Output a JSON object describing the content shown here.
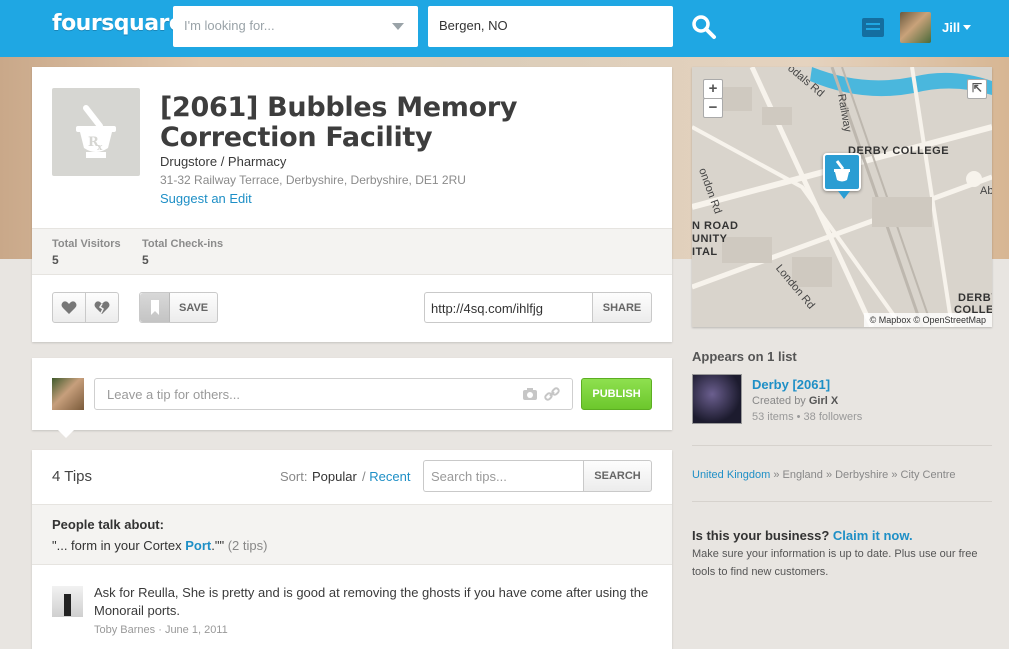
{
  "header": {
    "logo": "foursquare",
    "search_what_placeholder": "I'm looking for...",
    "search_where_value": "Bergen, NO",
    "user_name": "Jill"
  },
  "venue": {
    "title": "[2061] Bubbles Memory Correction Facility",
    "category": "Drugstore / Pharmacy",
    "address": "31-32 Railway Terrace, Derbyshire, Derbyshire, DE1 2RU",
    "suggest_edit": "Suggest an Edit",
    "stats": [
      {
        "label": "Total Visitors",
        "value": "5"
      },
      {
        "label": "Total Check-ins",
        "value": "5"
      }
    ],
    "save_label": "SAVE",
    "share_url": "http://4sq.com/ihlfjg",
    "share_label": "SHARE"
  },
  "tip_composer": {
    "placeholder": "Leave a tip for others...",
    "publish_label": "PUBLISH"
  },
  "tips": {
    "title": "4 Tips",
    "sort_label": "Sort:",
    "sort_popular": "Popular",
    "sort_separator": "/",
    "sort_recent": "Recent",
    "search_placeholder": "Search tips...",
    "search_label": "SEARCH",
    "talk_title": "People talk about:",
    "talk_quote_pre": "\"... form in your Cortex ",
    "talk_quote_highlight": "Port",
    "talk_quote_post": ".\"\"",
    "talk_quote_count": "(2 tips)",
    "items": [
      {
        "text": "Ask for Reulla, She is pretty and is good at removing the ghosts if you have come after using the Monorail ports.",
        "author": "Toby Barnes",
        "date": "June 1, 2011"
      }
    ]
  },
  "map": {
    "labels": [
      "DERBY COLLEGE",
      "N ROAD",
      "UNITY",
      "ITAL",
      "DERBY",
      "COLLEG"
    ],
    "roads": [
      "Railway",
      "odals Rd",
      "London Rd",
      "ondon Rd",
      "Ab"
    ],
    "credit": "© Mapbox © OpenStreetMap",
    "zoom_in": "+",
    "zoom_out": "−"
  },
  "sidebar": {
    "lists_heading": "Appears on 1 list",
    "list": {
      "name": "Derby [2061]",
      "created_by_label": "Created by",
      "creator": "Girl X",
      "stats": "53 items • 38 followers"
    },
    "breadcrumb": {
      "country": "United Kingdom",
      "rest": "» England » Derbyshire » City Centre"
    },
    "business": {
      "question": "Is this your business?",
      "claim": "Claim it now.",
      "text": "Make sure your information is up to date. Plus use our free tools to find new customers."
    }
  },
  "colors": {
    "topbar": "#1fa7e3",
    "link": "#1e8fc6",
    "publish": "#6cc72c"
  }
}
